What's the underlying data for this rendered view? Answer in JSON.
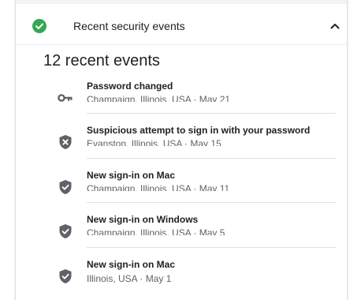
{
  "section": {
    "title": "Recent security events",
    "status_icon": "check-circle-icon",
    "expand_icon": "chevron-up-icon",
    "accent_color": "#34a853"
  },
  "summary": {
    "heading": "12 recent events"
  },
  "events": [
    {
      "title": "Password changed",
      "detail": "Champaign, Illinois, USA · May 21",
      "icon": "key-icon"
    },
    {
      "title": "Suspicious attempt to sign in with your password",
      "detail": "Evanston, Illinois, USA · May 15",
      "icon": "shield-x-icon"
    },
    {
      "title": "New sign-in on Mac",
      "detail": "Champaign, Illinois, USA · May 11",
      "icon": "shield-check-icon"
    },
    {
      "title": "New sign-in on Windows",
      "detail": "Champaign, Illinois, USA · May 5",
      "icon": "shield-check-icon"
    },
    {
      "title": "New sign-in on Mac",
      "detail": "Illinois, USA · May 1",
      "icon": "shield-check-icon"
    }
  ]
}
